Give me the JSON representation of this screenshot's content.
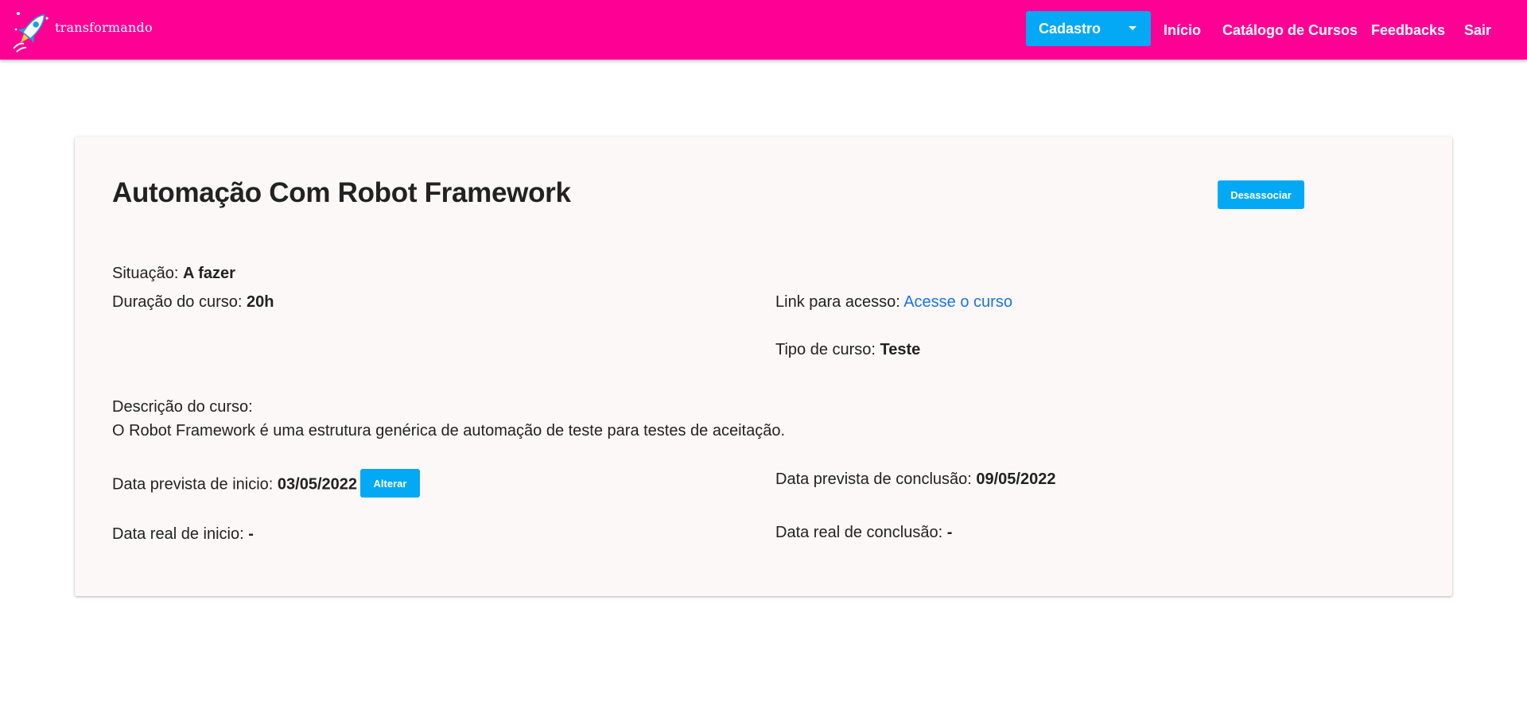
{
  "brand": {
    "name": "transformando"
  },
  "nav": {
    "cadastro_label": "Cadastro",
    "links": [
      "Início",
      "Catálogo de Cursos",
      "Feedbacks",
      "Sair"
    ]
  },
  "course": {
    "title": "Automação Com Robot Framework",
    "desassociar_label": "Desassociar",
    "situacao_label": "Situação: ",
    "situacao_value": "A fazer",
    "duracao_label": "Duração do curso: ",
    "duracao_value": "20h",
    "link_label": "Link para acesso: ",
    "link_text": "Acesse o curso",
    "tipo_label": "Tipo de curso: ",
    "tipo_value": "Teste",
    "descricao_label": "Descrição do curso:",
    "descricao_value": "O Robot Framework é uma estrutura genérica de automação de teste para testes de aceitação.",
    "inicio_prev_label": "Data prevista de inicio: ",
    "inicio_prev_value": "03/05/2022",
    "alterar_label": "Alterar",
    "conclusao_prev_label": "Data prevista de conclusão: ",
    "conclusao_prev_value": "09/05/2022",
    "inicio_real_label": "Data real de inicio: ",
    "inicio_real_value": "-",
    "conclusao_real_label": "Data real de conclusão: ",
    "conclusao_real_value": "-"
  },
  "colors": {
    "navbar": "#ff0095",
    "accent": "#03a9f4",
    "link": "#1a73e8",
    "card": "#fcf8f7"
  }
}
